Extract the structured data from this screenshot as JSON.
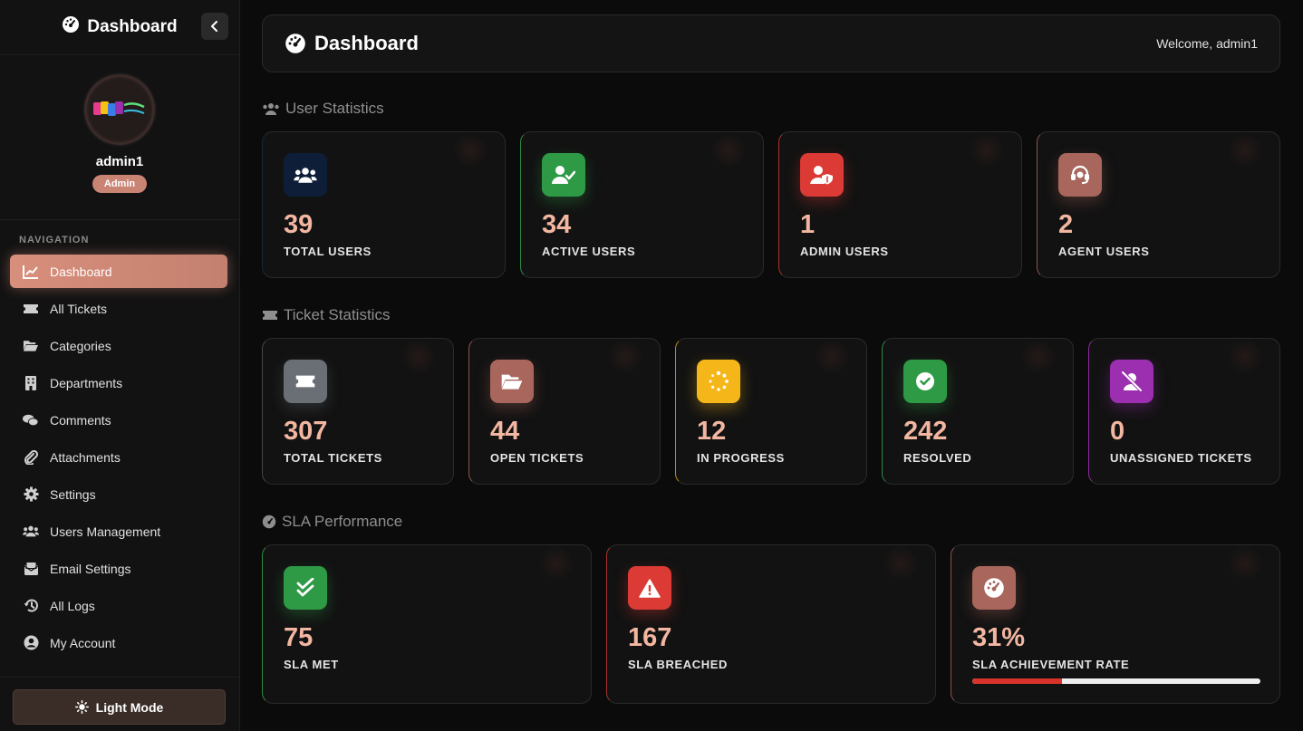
{
  "sidebar": {
    "brand": "Dashboard",
    "user": {
      "name": "admin1",
      "role": "Admin"
    },
    "nav_title": "NAVIGATION",
    "items": [
      {
        "label": "Dashboard",
        "icon": "chart-line-icon",
        "active": true
      },
      {
        "label": "All Tickets",
        "icon": "ticket-icon"
      },
      {
        "label": "Categories",
        "icon": "folder-open-icon"
      },
      {
        "label": "Departments",
        "icon": "building-icon"
      },
      {
        "label": "Comments",
        "icon": "comments-icon"
      },
      {
        "label": "Attachments",
        "icon": "paperclip-icon"
      },
      {
        "label": "Settings",
        "icon": "gear-icon"
      },
      {
        "label": "Users Management",
        "icon": "users-icon"
      },
      {
        "label": "Email Settings",
        "icon": "envelope-icon"
      },
      {
        "label": "All Logs",
        "icon": "history-icon"
      },
      {
        "label": "My Account",
        "icon": "user-circle-icon"
      }
    ],
    "light_mode": "Light Mode"
  },
  "header": {
    "title": "Dashboard",
    "welcome": "Welcome, admin1"
  },
  "sections": {
    "users": "User Statistics",
    "tickets": "Ticket Statistics",
    "sla": "SLA Performance"
  },
  "user_stats": [
    {
      "value": "39",
      "label": "TOTAL USERS",
      "color": "#0f1e38",
      "border": "#1c2638",
      "icon": "users-icon"
    },
    {
      "value": "34",
      "label": "ACTIVE USERS",
      "color": "#2e9a46",
      "border": "#2e8a45",
      "icon": "user-check-icon"
    },
    {
      "value": "1",
      "label": "ADMIN USERS",
      "color": "#dc3a34",
      "border": "#a8322d",
      "icon": "user-shield-icon"
    },
    {
      "value": "2",
      "label": "AGENT USERS",
      "color": "#a8665c",
      "border": "#8a554d",
      "icon": "headset-icon"
    }
  ],
  "ticket_stats": [
    {
      "value": "307",
      "label": "TOTAL TICKETS",
      "color": "#6a6f76",
      "border": "#44474b",
      "icon": "ticket-icon"
    },
    {
      "value": "44",
      "label": "OPEN TICKETS",
      "color": "#a8665c",
      "border": "#8a554d",
      "icon": "folder-open-icon"
    },
    {
      "value": "12",
      "label": "IN PROGRESS",
      "color": "#f5b619",
      "border": "#b88d1c",
      "icon": "spinner-icon"
    },
    {
      "value": "242",
      "label": "RESOLVED",
      "color": "#2e9a46",
      "border": "#2e8a45",
      "icon": "check-circle-icon"
    },
    {
      "value": "0",
      "label": "UNASSIGNED TICKETS",
      "color": "#9b2fb0",
      "border": "#8a2b9d",
      "icon": "user-slash-icon"
    }
  ],
  "sla_stats": [
    {
      "value": "75",
      "label": "SLA MET",
      "color": "#2e9a46",
      "border": "#2e8a45",
      "icon": "double-check-icon"
    },
    {
      "value": "167",
      "label": "SLA BREACHED",
      "color": "#dc3a34",
      "border": "#a8322d",
      "icon": "warning-icon"
    },
    {
      "value": "31%",
      "label": "SLA ACHIEVEMENT RATE",
      "color": "#a8665c",
      "border": "#8a554d",
      "icon": "gauge-icon",
      "progress": 0.31
    }
  ]
}
